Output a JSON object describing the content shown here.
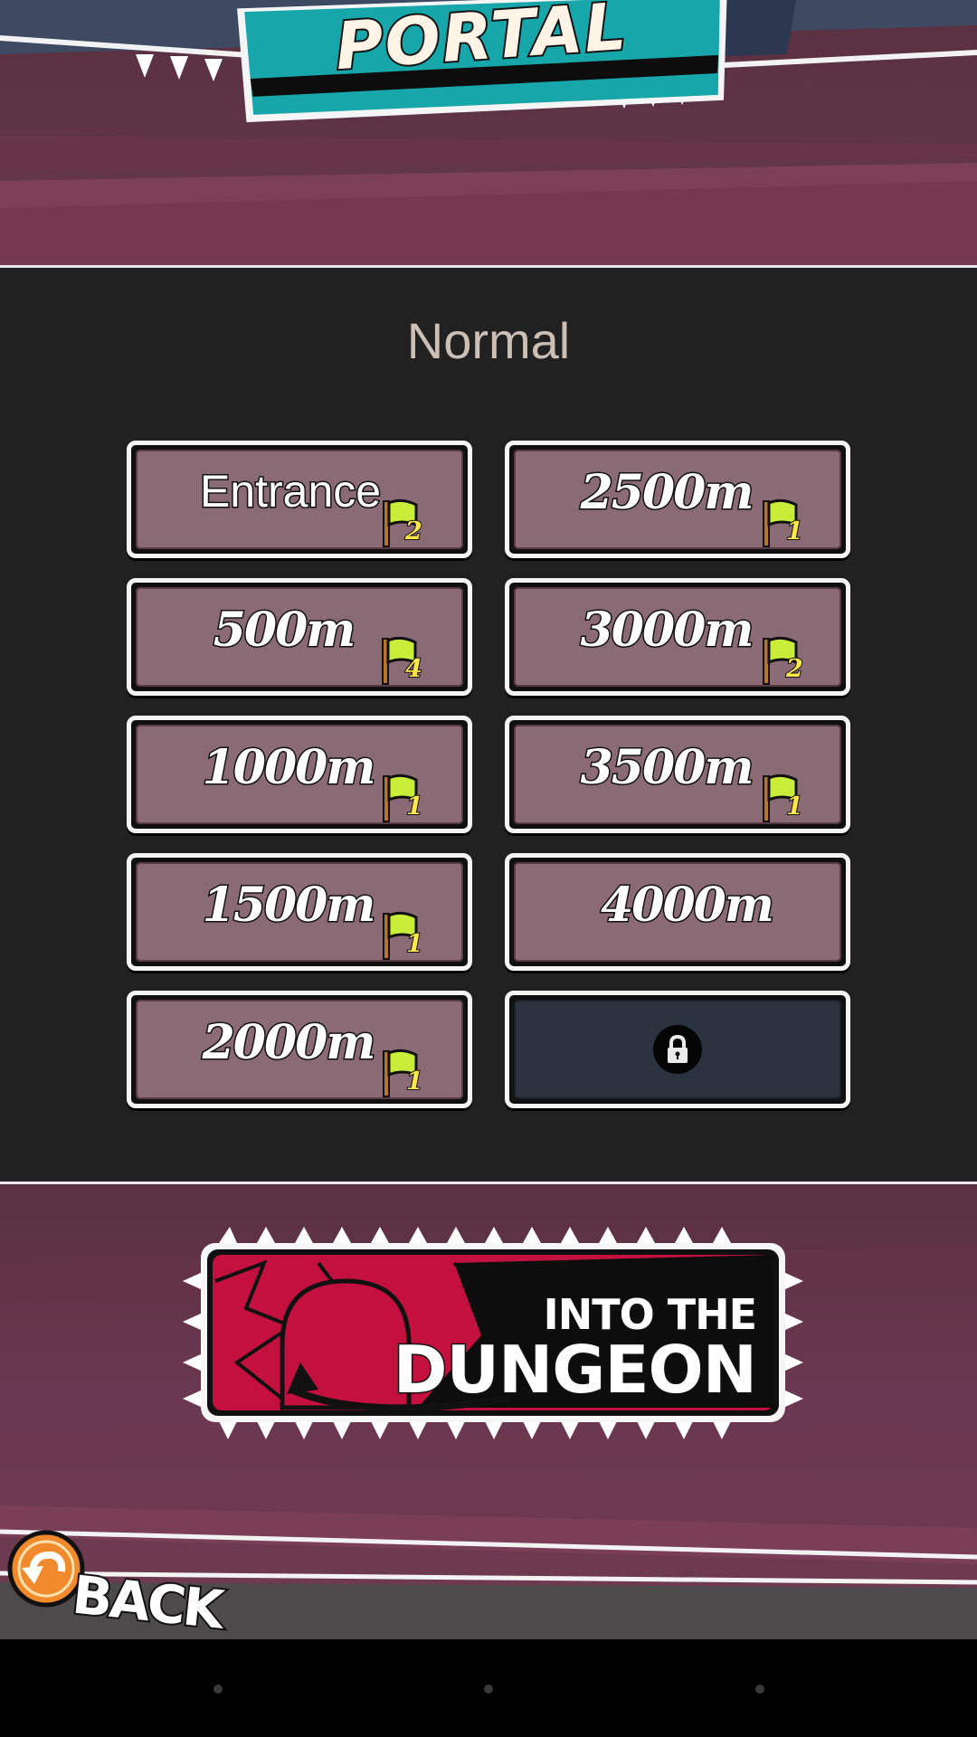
{
  "header": {
    "title": "PORTAL"
  },
  "mode": {
    "label": "Normal"
  },
  "levels": [
    {
      "name": "Entrance",
      "flags": "2",
      "locked": false
    },
    {
      "name": "2500m",
      "flags": "1",
      "locked": false
    },
    {
      "name": "500m",
      "flags": "4",
      "locked": false
    },
    {
      "name": "3000m",
      "flags": "2",
      "locked": false
    },
    {
      "name": "1000m",
      "flags": "1",
      "locked": false
    },
    {
      "name": "3500m",
      "flags": "1",
      "locked": false
    },
    {
      "name": "1500m",
      "flags": "1",
      "locked": false
    },
    {
      "name": "4000m",
      "flags": "",
      "locked": false
    },
    {
      "name": "2000m",
      "flags": "1",
      "locked": false
    },
    {
      "name": "",
      "flags": "",
      "locked": true
    }
  ],
  "dungeon_button": {
    "line1": "INTO THE",
    "line2": "DUNGEON"
  },
  "back_button": {
    "label": "BACK"
  },
  "icons": {
    "flag": "green-flag-icon",
    "lock": "lock-icon",
    "back": "back-arrow-icon",
    "dungeon": "dungeon-arrow-icon"
  },
  "colors": {
    "panel_bg": "#212121",
    "level_tile": "#8a6a74",
    "locked_tile": "#2c3340",
    "portal_teal": "#17a7aa",
    "dungeon_red": "#c4103e",
    "flag_green": "#c8ee3a",
    "flag_count": "#ffe74a",
    "back_orange": "#f08a2c"
  }
}
